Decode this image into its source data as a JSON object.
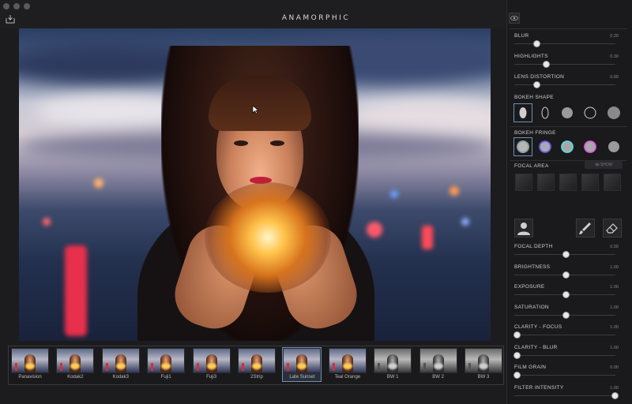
{
  "app": {
    "title": "ANAMORPHIC"
  },
  "colors": {
    "accent": "#6f8fb5",
    "panel_bg": "#1a1a1c",
    "window_bg": "#1c1c1e"
  },
  "filters": [
    {
      "label": "Panavision",
      "selected": false,
      "mono": false
    },
    {
      "label": "Kodak2",
      "selected": false,
      "mono": false
    },
    {
      "label": "Kodak3",
      "selected": false,
      "mono": false
    },
    {
      "label": "Fuji1",
      "selected": false,
      "mono": false
    },
    {
      "label": "Fuji3",
      "selected": false,
      "mono": false
    },
    {
      "label": "2Strip",
      "selected": false,
      "mono": false
    },
    {
      "label": "Late Sunset",
      "selected": true,
      "mono": false
    },
    {
      "label": "Teal Orange",
      "selected": false,
      "mono": false
    },
    {
      "label": "BW 1",
      "selected": false,
      "mono": true
    },
    {
      "label": "BW 2",
      "selected": false,
      "mono": true
    },
    {
      "label": "BW 3",
      "selected": false,
      "mono": true
    }
  ],
  "top_sliders": [
    {
      "label": "BLUR",
      "value": "0.20",
      "level": 0.2
    },
    {
      "label": "HIGHLIGHTS",
      "value": "0.30",
      "level": 0.3
    },
    {
      "label": "LENS DISTORTION",
      "value": "0.60",
      "level": 0.2
    }
  ],
  "bokeh_shape": {
    "label": "BOKEH SHAPE"
  },
  "bokeh_fringe": {
    "label": "BOKEH FRINGE"
  },
  "focal_area": {
    "label": "FOCAL AREA",
    "toggle": "SHOW"
  },
  "bottom_sliders": [
    {
      "label": "FOCAL DEPTH",
      "value": "0.50",
      "level": 0.5
    },
    {
      "label": "BRIGHTNESS",
      "value": "1.00",
      "level": 0.5
    },
    {
      "label": "EXPOSURE",
      "value": "1.00",
      "level": 0.5
    },
    {
      "label": "SATURATION",
      "value": "1.00",
      "level": 0.5
    },
    {
      "label": "CLARITY - FOCUS",
      "value": "1.00",
      "level": 0.0
    },
    {
      "label": "CLARITY - BLUR",
      "value": "1.00",
      "level": 0.0
    },
    {
      "label": "FILM GRAIN",
      "value": "0.00",
      "level": 0.0
    },
    {
      "label": "FILTER INTENSITY",
      "value": "1.00",
      "level": 1.0
    }
  ]
}
